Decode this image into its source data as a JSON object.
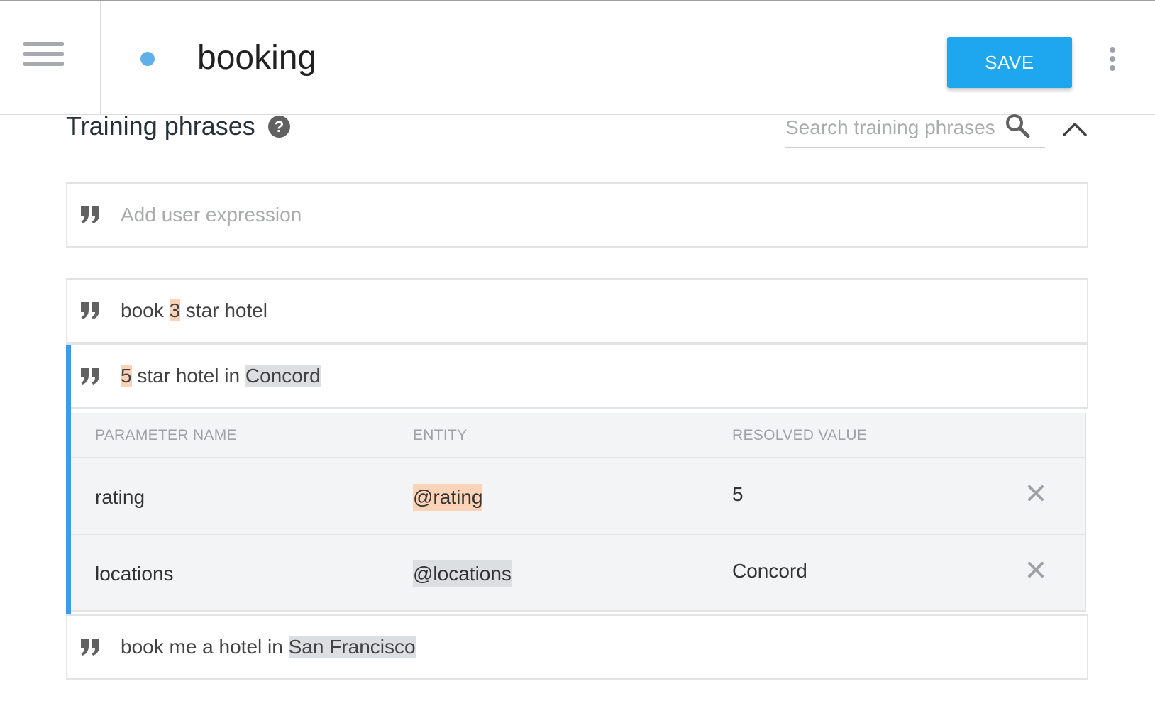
{
  "header": {
    "intent_name": "booking",
    "save_label": "SAVE",
    "status_color": "#5fb0ea",
    "accent_color": "#1ea7ef"
  },
  "training": {
    "title": "Training phrases",
    "help_icon_glyph": "?",
    "search_placeholder": "Search training phrases",
    "add_placeholder": "Add user expression"
  },
  "phrases": [
    {
      "parts": [
        {
          "text": "book ",
          "hl": null
        },
        {
          "text": "3",
          "hl": "orange"
        },
        {
          "text": " star hotel",
          "hl": null
        }
      ]
    },
    {
      "parts": [
        {
          "text": "5",
          "hl": "orange"
        },
        {
          "text": " star hotel in ",
          "hl": null
        },
        {
          "text": "Concord",
          "hl": "gray"
        }
      ],
      "selected": true
    },
    {
      "parts": [
        {
          "text": "book me a hotel in ",
          "hl": null
        },
        {
          "text": "San Francisco",
          "hl": "gray"
        }
      ]
    }
  ],
  "param_table": {
    "headers": [
      "PARAMETER NAME",
      "ENTITY",
      "RESOLVED VALUE"
    ],
    "rows": [
      {
        "name": "rating",
        "entity": "@rating",
        "entity_hl": "orange",
        "value": "5"
      },
      {
        "name": "locations",
        "entity": "@locations",
        "entity_hl": "gray",
        "value": "Concord"
      }
    ]
  },
  "highlight_colors": {
    "orange": "#fcd3b6",
    "gray": "#dcdfe1"
  }
}
